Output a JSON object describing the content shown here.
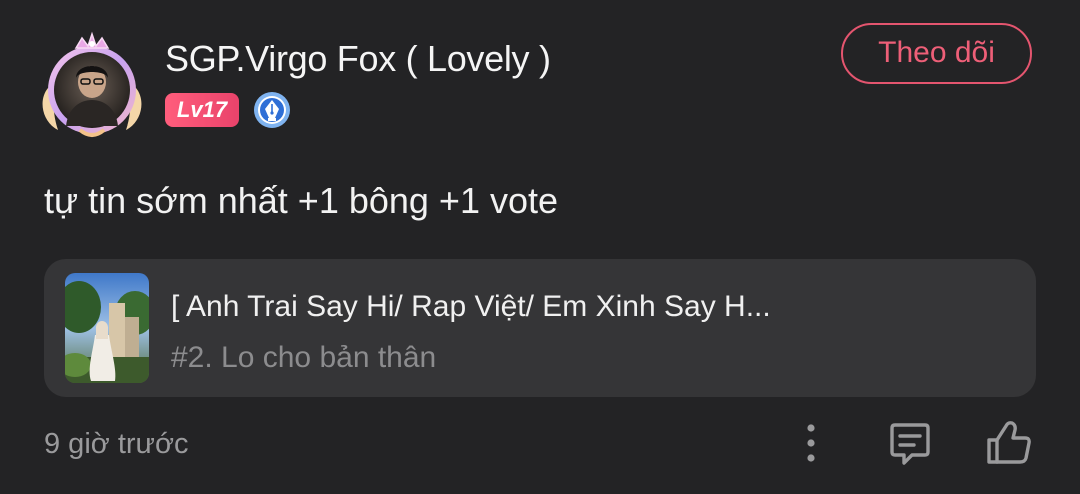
{
  "post": {
    "author": {
      "name": "SGP.Virgo Fox ( Lovely )",
      "level": "Lv17",
      "badge_icon": "pen-nib-badge-icon",
      "avatar_icon": "avatar-with-crown-frame"
    },
    "follow_label": "Theo dõi",
    "content": "tự tin sớm nhất +1 bông +1 vote",
    "linked_story": {
      "title": "[ Anh Trai Say Hi/ Rap Việt/ Em Xinh Say H...",
      "subtitle": "#2. Lo cho bản thân",
      "thumbnail_icon": "story-cover-thumbnail"
    },
    "timestamp": "9 giờ trước",
    "actions": {
      "more_icon": "more-vertical-icon",
      "comment_icon": "comment-icon",
      "like_icon": "thumbs-up-icon"
    }
  },
  "colors": {
    "background": "#232325",
    "card": "#353537",
    "accent": "#e4556f",
    "level_badge": "#f0506f",
    "muted_text": "#9a9a9c"
  }
}
